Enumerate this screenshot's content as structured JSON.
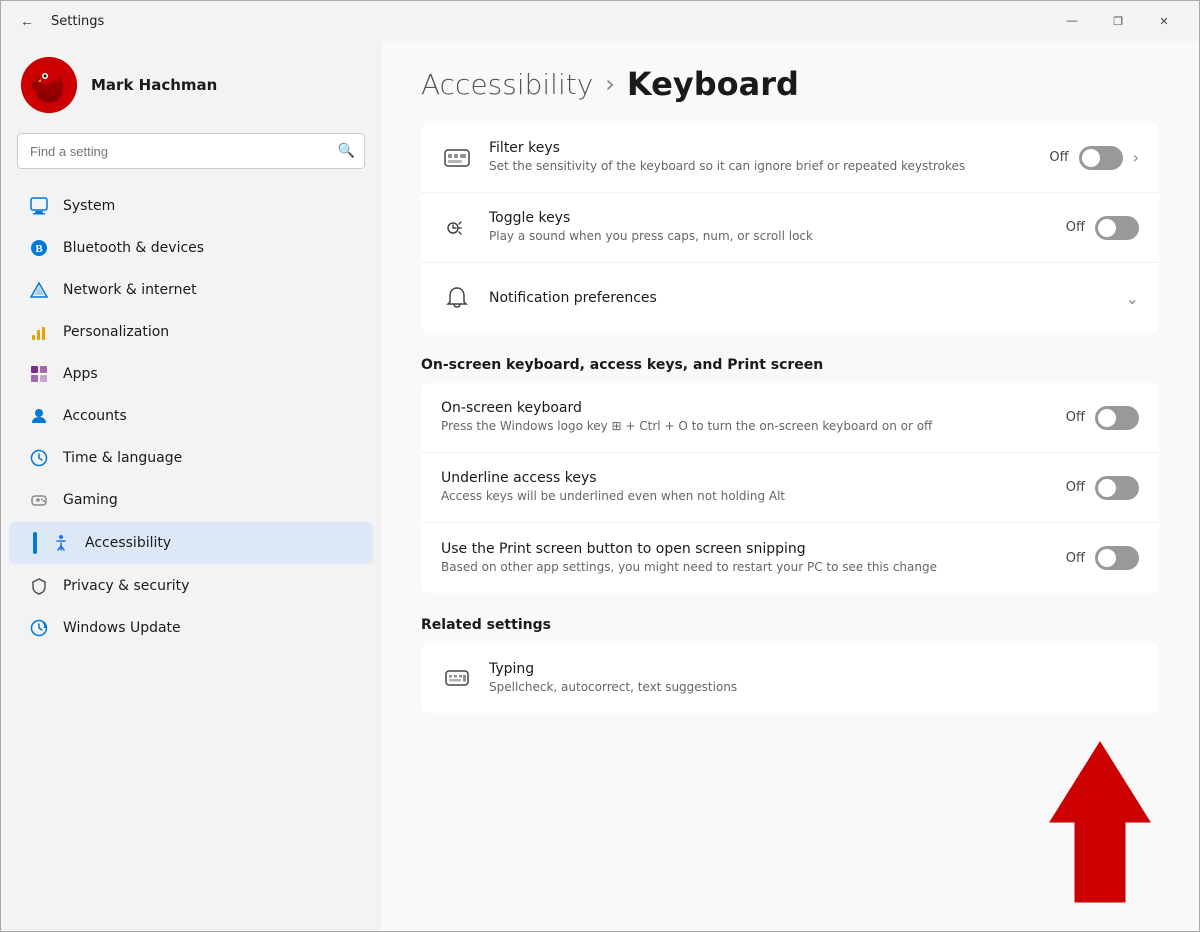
{
  "window": {
    "title": "Settings",
    "controls": {
      "minimize": "—",
      "maximize": "❐",
      "close": "✕"
    }
  },
  "user": {
    "name": "Mark Hachman"
  },
  "search": {
    "placeholder": "Find a setting"
  },
  "nav": {
    "items": [
      {
        "id": "system",
        "label": "System",
        "icon": "🖥"
      },
      {
        "id": "bluetooth",
        "label": "Bluetooth & devices",
        "icon": "Ⓑ"
      },
      {
        "id": "network",
        "label": "Network & internet",
        "icon": "📶"
      },
      {
        "id": "personalization",
        "label": "Personalization",
        "icon": "✏"
      },
      {
        "id": "apps",
        "label": "Apps",
        "icon": "⊞"
      },
      {
        "id": "accounts",
        "label": "Accounts",
        "icon": "👤"
      },
      {
        "id": "time",
        "label": "Time & language",
        "icon": "🕐"
      },
      {
        "id": "gaming",
        "label": "Gaming",
        "icon": "🎮"
      },
      {
        "id": "accessibility",
        "label": "Accessibility",
        "icon": "♿",
        "active": true
      },
      {
        "id": "privacy",
        "label": "Privacy & security",
        "icon": "🛡"
      },
      {
        "id": "update",
        "label": "Windows Update",
        "icon": "🔄"
      }
    ]
  },
  "page": {
    "breadcrumb": "Accessibility",
    "separator": "›",
    "title": "Keyboard"
  },
  "sections": [
    {
      "id": "top-settings",
      "rows": [
        {
          "id": "filter-keys",
          "icon": "⌨",
          "title": "Filter keys",
          "desc": "Set the sensitivity of the keyboard so it can ignore brief or repeated keystrokes",
          "controlType": "toggle-chevron",
          "toggleState": "off",
          "toggleLabel": "Off"
        },
        {
          "id": "toggle-keys",
          "icon": "🔊",
          "title": "Toggle keys",
          "desc": "Play a sound when you press caps, num, or scroll lock",
          "controlType": "toggle",
          "toggleState": "off",
          "toggleLabel": "Off"
        },
        {
          "id": "notification-prefs",
          "icon": "🔔",
          "title": "Notification preferences",
          "desc": "",
          "controlType": "chevron-down",
          "toggleLabel": ""
        }
      ]
    }
  ],
  "section_label_1": "On-screen keyboard, access keys, and Print screen",
  "section2_rows": [
    {
      "id": "onscreen-keyboard",
      "title": "On-screen keyboard",
      "desc": "Press the Windows logo key ⊞ + Ctrl + O to turn the on-screen keyboard on or off",
      "toggleState": "off",
      "toggleLabel": "Off"
    },
    {
      "id": "underline-access",
      "title": "Underline access keys",
      "desc": "Access keys will be underlined even when not holding Alt",
      "toggleState": "off",
      "toggleLabel": "Off"
    },
    {
      "id": "print-screen",
      "title": "Use the Print screen button to open screen snipping",
      "desc": "Based on other app settings, you might need to restart your PC to see this change",
      "toggleState": "off",
      "toggleLabel": "Off"
    }
  ],
  "section_label_2": "Related settings",
  "section3_rows": [
    {
      "id": "typing",
      "icon": "⌨",
      "title": "Typing",
      "desc": "Spellcheck, autocorrect, text suggestions"
    }
  ]
}
